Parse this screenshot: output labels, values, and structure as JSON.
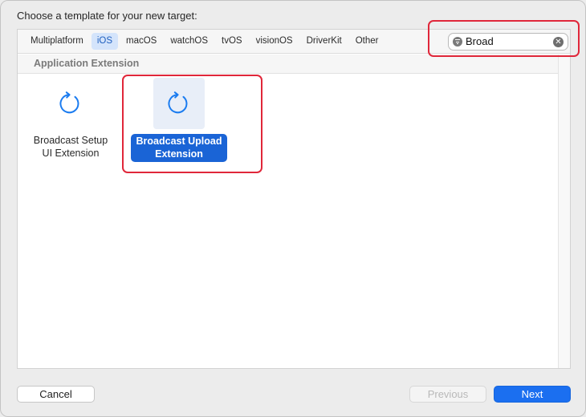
{
  "dialog": {
    "heading": "Choose a template for your new target:"
  },
  "tabs": [
    {
      "label": "Multiplatform",
      "active": false
    },
    {
      "label": "iOS",
      "active": true
    },
    {
      "label": "macOS",
      "active": false
    },
    {
      "label": "watchOS",
      "active": false
    },
    {
      "label": "tvOS",
      "active": false
    },
    {
      "label": "visionOS",
      "active": false
    },
    {
      "label": "DriverKit",
      "active": false
    },
    {
      "label": "Other",
      "active": false
    }
  ],
  "search": {
    "value": "Broad",
    "filter_icon": "filter-icon",
    "clear_icon": "clear-icon"
  },
  "section": {
    "title": "Application Extension"
  },
  "templates": [
    {
      "line1": "Broadcast Setup",
      "line2": "UI Extension",
      "icon": "refresh-arrow-icon",
      "selected": false
    },
    {
      "line1": "Broadcast Upload",
      "line2": "Extension",
      "icon": "refresh-arrow-icon",
      "selected": true
    }
  ],
  "buttons": {
    "cancel": "Cancel",
    "previous": "Previous",
    "next": "Next"
  },
  "colors": {
    "accent": "#1a64d6",
    "highlight": "#e0273a",
    "icon": "#1b7cf0"
  }
}
